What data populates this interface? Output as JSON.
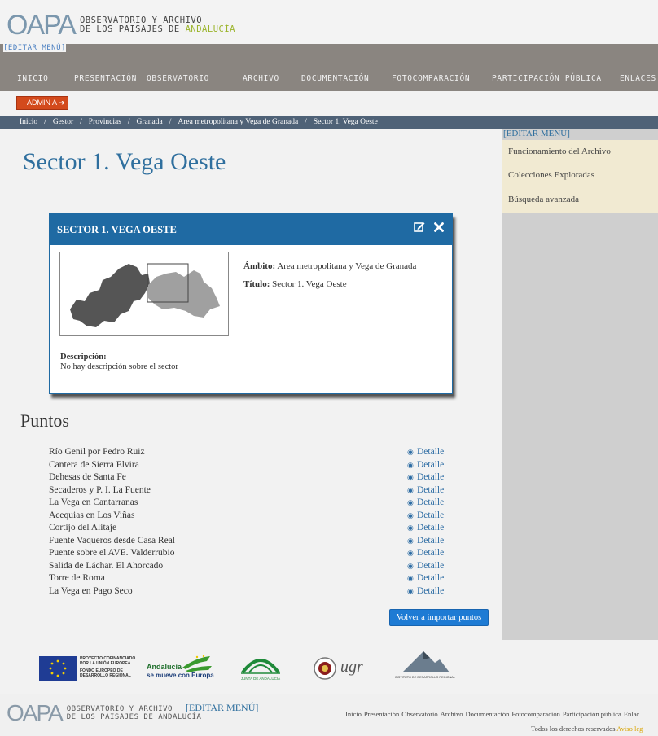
{
  "header": {
    "logo_mark": "OAPA",
    "logo_line1": "OBSERVATORIO Y ARCHIVO",
    "logo_line2": "DE LOS PAISAJES DE",
    "logo_line2_hl": "ANDALUCÍA",
    "edit_menu": "[EDITAR MENÚ]"
  },
  "nav": {
    "items": [
      "INICIO",
      "PRESENTACIÓN",
      "OBSERVATORIO",
      "ARCHIVO",
      "DOCUMENTACIÓN",
      "FOTOCOMPARACIÓN",
      "PARTICIPACIÓN PÚBLICA",
      "ENLACES"
    ]
  },
  "admin": {
    "label": "ADMIN A",
    "arrow": "➔"
  },
  "breadcrumb": [
    "Inicio",
    "Gestor",
    "Provincias",
    "Granada",
    "Area metropolitana y Vega de Granada",
    "Sector 1. Vega Oeste"
  ],
  "page_title": "Sector 1. Vega Oeste",
  "card": {
    "title": "SECTOR 1. VEGA OESTE",
    "ambito_label": "Ámbito:",
    "ambito_value": "Area metropolitana y Vega de Granada",
    "titulo_label": "Título:",
    "titulo_value": "Sector 1. Vega Oeste",
    "descripcion_label": "Descripción:",
    "descripcion_value": "No hay descripción sobre el sector"
  },
  "puntos": {
    "title": "Puntos",
    "detail_label": "Detalle",
    "items": [
      "Río Genil por Pedro Ruiz",
      "Cantera de Sierra Elvira",
      "Dehesas de Santa Fe",
      "Secaderos y P. I. La Fuente",
      "La Vega en Cantarranas",
      "Acequias en Los Viñas",
      "Cortijo del Alitaje",
      "Fuente Vaqueros desde Casa Real",
      "Puente sobre el AVE. Valderrubio",
      "Salida de Láchar. El Ahorcado",
      "Torre de Roma",
      "La Vega en Pago Seco"
    ],
    "reimport_button": "Volver a importar puntos"
  },
  "sidebar": {
    "edit_menu": "[EDITAR MENU]",
    "items": [
      "Funcionamiento del Archivo",
      "Colecciones Exploradas",
      "Búsqueda avanzada"
    ]
  },
  "logos": {
    "eu_line1": "PROYECTO COFINANCIADO",
    "eu_line2": "POR LA UNIÓN EUROPEA",
    "eu_line3": "FONDO EUROPEO DE",
    "eu_line4": "DESARROLLO REGIONAL",
    "andalucia_line1": "Andalucía",
    "andalucia_line2": "se mueve con Europa",
    "junta": "JUNTA DE ANDALUCIA",
    "ugr": "ugr",
    "idr": "INSTITUTO DE DESARROLLO REGIONAL"
  },
  "footer": {
    "edit_menu": "[EDITAR MENÚ]",
    "links": [
      "Inicio",
      "Presentación",
      "Observatorio",
      "Archivo",
      "Documentación",
      "Fotocomparación",
      "Participación pública",
      "Enlac"
    ],
    "rights": "Todos los derechos reservados",
    "aviso": "Aviso leg"
  },
  "colors": {
    "nav_bg": "#8a8580",
    "breadcrumb_bg": "#4f6277",
    "card_header": "#1f6aa3",
    "title_blue": "#2f6f9e",
    "admin_orange": "#d34a1c",
    "sidebar_menu_bg": "#f1ead2"
  }
}
